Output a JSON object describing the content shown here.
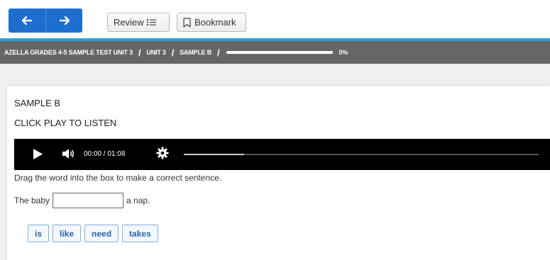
{
  "toolbar": {
    "review_label": "Review",
    "bookmark_label": "Bookmark"
  },
  "icons": {
    "back": "arrow-left-icon",
    "forward": "arrow-right-icon",
    "review": "list-icon",
    "bookmark": "bookmark-icon",
    "play": "play-icon",
    "volume": "volume-icon",
    "settings": "gear-icon"
  },
  "breadcrumb": {
    "test": "AZELLA GRADES 4-5 SAMPLE TEST UNIT 3",
    "unit": "UNIT 3",
    "item": "SAMPLE B",
    "separator": "/"
  },
  "progress": {
    "value": 0,
    "label": "0%"
  },
  "question": {
    "title": "SAMPLE B",
    "prompt": "CLICK PLAY TO LISTEN",
    "instruction": "Drag the word into the box to make a correct sentence.",
    "sentence_start": "The baby",
    "sentence_end": "a nap."
  },
  "audio": {
    "time": "00:00 / 01:08",
    "buffered_fraction": 0.17
  },
  "word_bank": [
    "is",
    "like",
    "need",
    "takes"
  ],
  "colors": {
    "nav_blue": "#1e6ecf",
    "accent_line": "#2aa3dc",
    "breadcrumb_bg": "#666666",
    "chip_text": "#2864a8",
    "chip_border": "#7fb0dd"
  }
}
